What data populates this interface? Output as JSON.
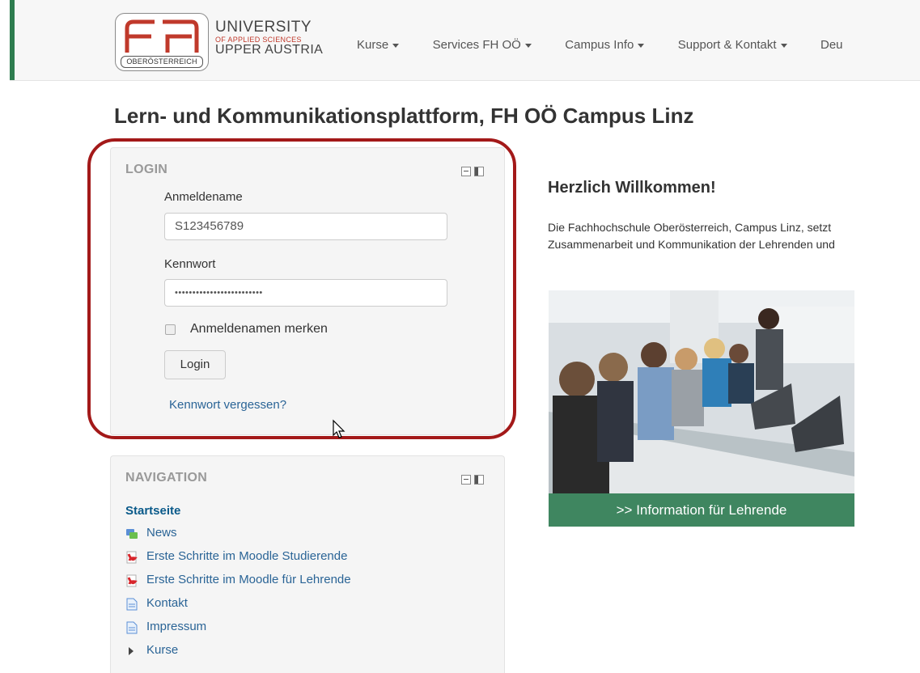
{
  "header": {
    "logo_text": "fh",
    "logo_subtitle": "OBERÖSTERREICH",
    "university_line1": "UNIVERSITY",
    "university_line2": "OF APPLIED SCIENCES",
    "university_line3": "UPPER AUSTRIA",
    "nav": [
      {
        "label": "Kurse"
      },
      {
        "label": "Services FH OÖ"
      },
      {
        "label": "Campus Info"
      },
      {
        "label": "Support & Kontakt"
      },
      {
        "label": "Deu"
      }
    ],
    "accent_color": "#2e7d4f"
  },
  "page_title": "Lern- und Kommunikationsplattform, FH OÖ Campus Linz",
  "login": {
    "title": "LOGIN",
    "username_label": "Anmeldename",
    "username_value": "S123456789",
    "password_label": "Kennwort",
    "password_value": "•••••••••••••••••••••••••",
    "remember_label": "Anmeldenamen merken",
    "remember_checked": false,
    "login_button": "Login",
    "forgot_link": "Kennwort vergessen?",
    "highlight_color": "#a31919"
  },
  "navigation": {
    "title": "NAVIGATION",
    "home": "Startseite",
    "items": [
      {
        "label": "News",
        "icon": "forum-icon"
      },
      {
        "label": "Erste Schritte im Moodle Studierende",
        "icon": "pdf-icon"
      },
      {
        "label": "Erste Schritte im Moodle für Lehrende",
        "icon": "pdf-icon"
      },
      {
        "label": "Kontakt",
        "icon": "page-icon"
      },
      {
        "label": "Impressum",
        "icon": "page-icon"
      },
      {
        "label": "Kurse",
        "icon": "expand-arrow-icon"
      }
    ]
  },
  "main": {
    "welcome": "Herzlich Willkommen!",
    "intro_line1": "Die Fachhochschule Oberösterreich, Campus Linz, setzt",
    "intro_line2": "Zusammenarbeit und Kommunikation der Lehrenden und",
    "photo_caption": ">> Information für Lehrende",
    "caption_color": "#3f8660"
  }
}
